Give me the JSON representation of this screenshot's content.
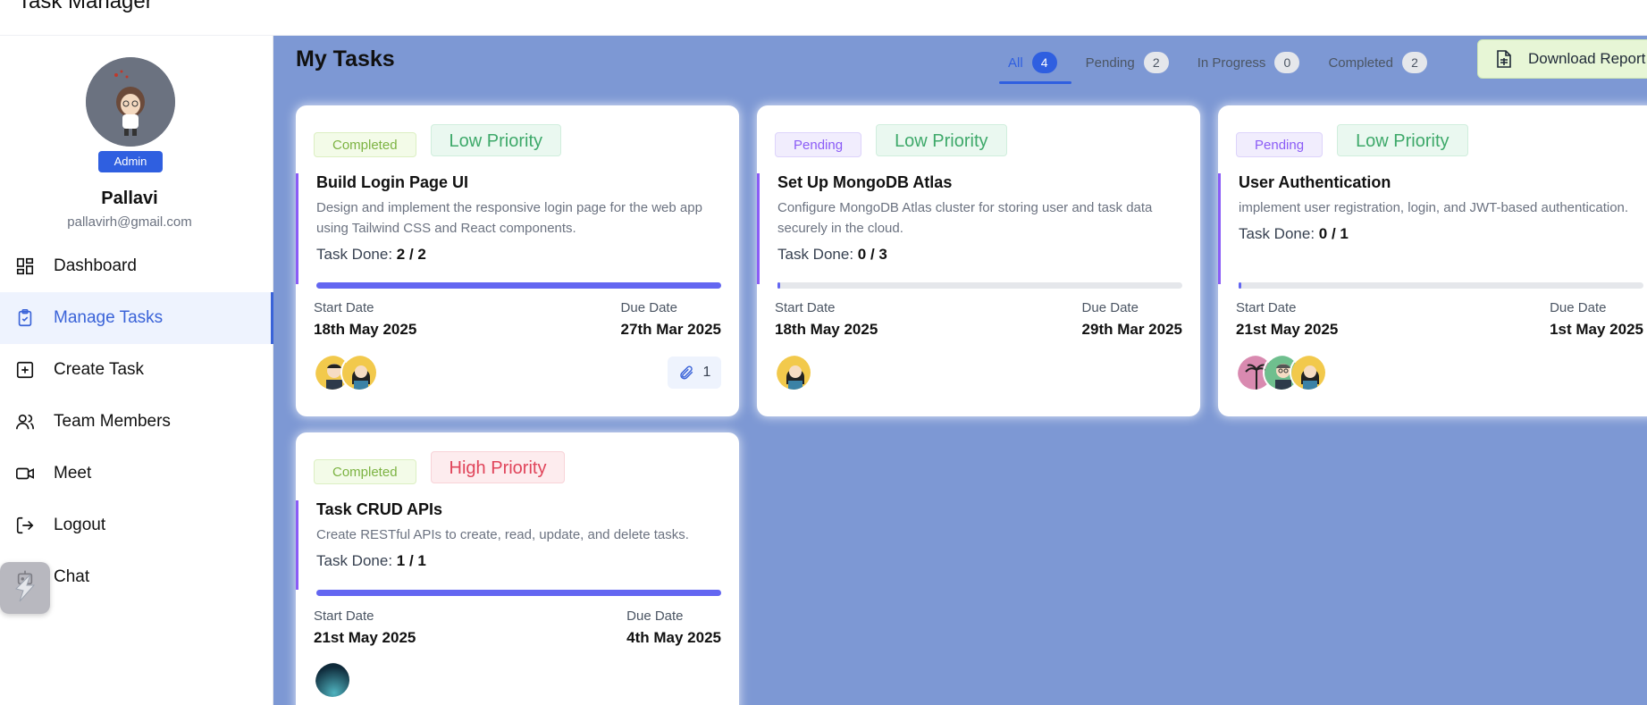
{
  "app": {
    "title": "Task Manager"
  },
  "user": {
    "role": "Admin",
    "name": "Pallavi",
    "email": "pallavirh@gmail.com"
  },
  "sidebar": {
    "items": [
      {
        "label": "Dashboard",
        "icon": "dashboard-icon"
      },
      {
        "label": "Manage Tasks",
        "icon": "clipboard-check-icon",
        "active": true
      },
      {
        "label": "Create Task",
        "icon": "plus-square-icon"
      },
      {
        "label": "Team Members",
        "icon": "users-icon"
      },
      {
        "label": "Meet",
        "icon": "video-icon"
      },
      {
        "label": "Logout",
        "icon": "logout-icon"
      },
      {
        "label": "Chat",
        "icon": "bot-icon"
      }
    ]
  },
  "main": {
    "title": "My Tasks",
    "tabs": [
      {
        "label": "All",
        "count": "4",
        "active": true
      },
      {
        "label": "Pending",
        "count": "2"
      },
      {
        "label": "In Progress",
        "count": "0"
      },
      {
        "label": "Completed",
        "count": "2"
      }
    ],
    "download_label": "Download Report"
  },
  "cards": [
    {
      "status": "Completed",
      "priority": "Low Priority",
      "title": "Build Login Page UI",
      "description": "Design and implement the responsive login page for the web app using Tailwind CSS and React components.",
      "done_label": "Task Done:",
      "done_value": "2 / 2",
      "progress": 1.0,
      "start_label": "Start Date",
      "start_date": "18th May 2025",
      "due_label": "Due Date",
      "due_date": "27th Mar 2025",
      "attachments": "1"
    },
    {
      "status": "Pending",
      "priority": "Low Priority",
      "title": "Set Up MongoDB Atlas",
      "description": "Configure MongoDB Atlas cluster for storing user and task data securely in the cloud.",
      "done_label": "Task Done:",
      "done_value": "0 / 3",
      "progress": 0.0,
      "start_label": "Start Date",
      "start_date": "18th May 2025",
      "due_label": "Due Date",
      "due_date": "29th Mar 2025"
    },
    {
      "status": "Pending",
      "priority": "Low Priority",
      "title": "User Authentication",
      "description": "implement user registration, login, and JWT-based authentication.",
      "done_label": "Task Done:",
      "done_value": "0 / 1",
      "progress": 0.0,
      "start_label": "Start Date",
      "start_date": "21st May 2025",
      "due_label": "Due Date",
      "due_date": "1st May 2025"
    },
    {
      "status": "Completed",
      "priority": "High Priority",
      "title": "Task CRUD APIs",
      "description": "Create RESTful APIs to create, read, update, and delete tasks.",
      "done_label": "Task Done:",
      "done_value": "1 / 1",
      "progress": 1.0,
      "start_label": "Start Date",
      "start_date": "21st May 2025",
      "due_label": "Due Date",
      "due_date": "4th May 2025"
    }
  ],
  "colors": {
    "accent": "#2f5fe0",
    "main_bg": "#7d98d4",
    "progress": "#6366f1",
    "completed": "#7cb342",
    "pending": "#8b5cf6",
    "low_priority": "#3ea96a",
    "high_priority": "#e0445a"
  }
}
